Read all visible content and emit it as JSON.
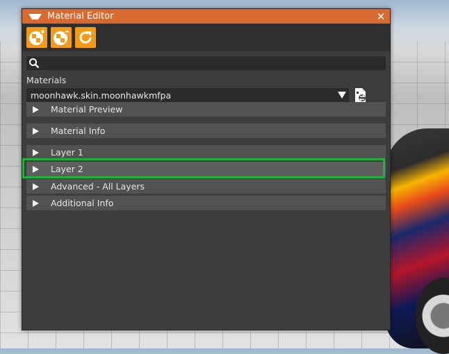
{
  "window": {
    "title": "Material Editor",
    "close_glyph": "✕"
  },
  "toolbar": {
    "buttons": [
      {
        "icon": "add-material-icon"
      },
      {
        "icon": "remove-material-icon"
      },
      {
        "icon": "refresh-icon"
      }
    ],
    "accent": "#f39a17"
  },
  "search": {
    "icon": "search-icon",
    "value": "",
    "placeholder": ""
  },
  "materials": {
    "label": "Materials",
    "selected": "moonhawk.skin.moonhawkmfpa"
  },
  "sections": [
    {
      "label": "Material Preview"
    },
    {
      "label": "Material Info"
    },
    {
      "label": "Layer 1"
    },
    {
      "label": "Layer 2"
    },
    {
      "label": "Advanced - All Layers"
    },
    {
      "label": "Additional Info"
    }
  ],
  "colors": {
    "titlebar": "#d8692f",
    "highlight": "#1fb23a",
    "panel": "#3d3d3d"
  }
}
